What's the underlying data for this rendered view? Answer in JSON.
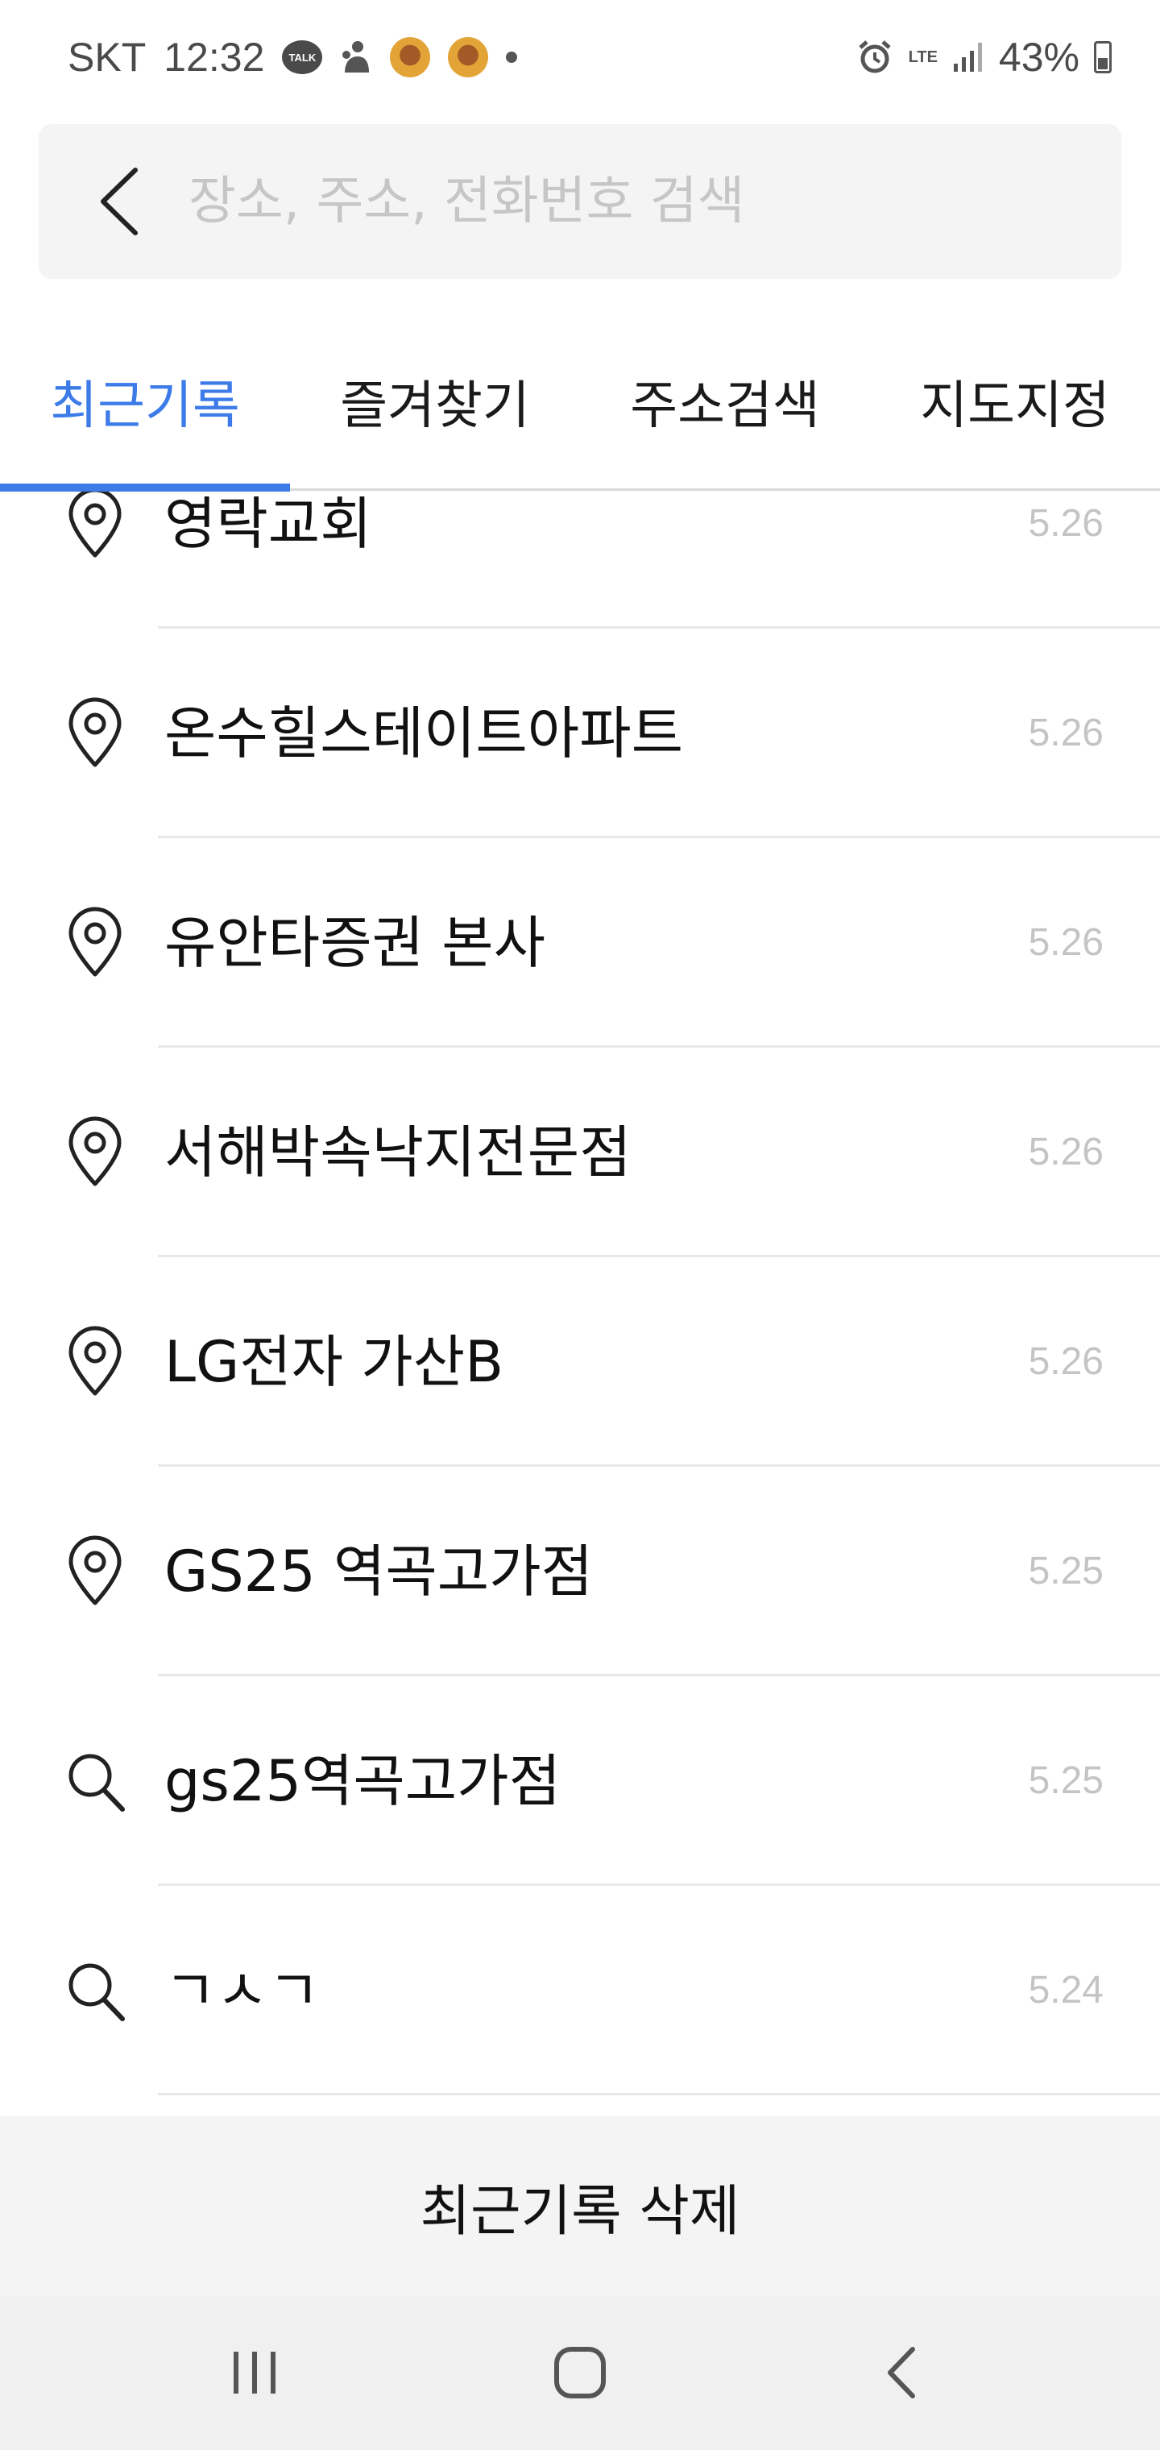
{
  "status_bar": {
    "carrier": "SKT",
    "time": "12:32",
    "talk_label": "TALK",
    "network": "LTE",
    "battery": "43%",
    "icons": [
      "kakaotalk-icon",
      "notification-icon",
      "avatar-icon",
      "avatar-icon",
      "dot-icon",
      "alarm-icon",
      "lte-icon",
      "signal-icon",
      "battery-icon"
    ]
  },
  "search": {
    "placeholder": "장소, 주소, 전화번호 검색",
    "value": ""
  },
  "tabs": [
    {
      "label": "최근기록",
      "active": true
    },
    {
      "label": "즐겨찾기",
      "active": false
    },
    {
      "label": "주소검색",
      "active": false
    },
    {
      "label": "지도지정",
      "active": false
    }
  ],
  "history": [
    {
      "label": "영락교회",
      "date": "5.26",
      "icon": "pin-icon"
    },
    {
      "label": "온수힐스테이트아파트",
      "date": "5.26",
      "icon": "pin-icon"
    },
    {
      "label": "유안타증권 본사",
      "date": "5.26",
      "icon": "pin-icon"
    },
    {
      "label": "서해박속낙지전문점",
      "date": "5.26",
      "icon": "pin-icon"
    },
    {
      "label": "LG전자 가산B",
      "date": "5.26",
      "icon": "pin-icon"
    },
    {
      "label": "GS25 역곡고가점",
      "date": "5.25",
      "icon": "pin-icon"
    },
    {
      "label": "gs25역곡고가점",
      "date": "5.25",
      "icon": "search-icon"
    },
    {
      "label": "ㄱㅅㄱ",
      "date": "5.24",
      "icon": "search-icon"
    }
  ],
  "delete_label": "최근기록 삭제",
  "colors": {
    "accent": "#3c7be8",
    "date_text": "#c4c4c4",
    "placeholder": "#c6c6c6",
    "panel_bg": "#f4f4f4"
  }
}
